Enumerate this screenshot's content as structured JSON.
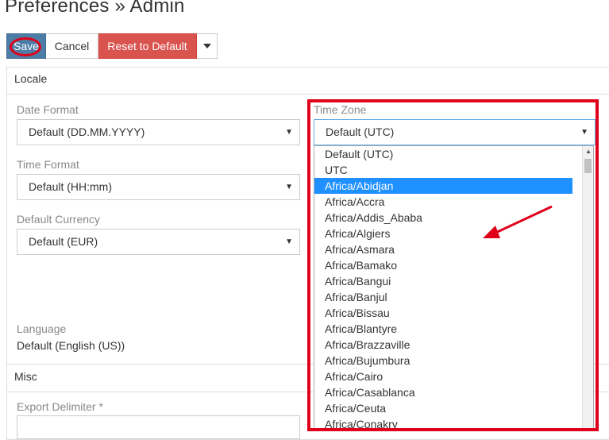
{
  "page": {
    "title": "Preferences » Admin"
  },
  "toolbar": {
    "save_label": "Save",
    "cancel_label": "Cancel",
    "reset_label": "Reset to Default",
    "caret_icon": "caret-down-icon"
  },
  "locale": {
    "heading": "Locale",
    "date_format": {
      "label": "Date Format",
      "value": "Default (DD.MM.YYYY)"
    },
    "time_format": {
      "label": "Time Format",
      "value": "Default (HH:mm)"
    },
    "default_currency": {
      "label": "Default Currency",
      "value": "Default (EUR)"
    },
    "language": {
      "label": "Language",
      "value": "Default (English (US))"
    },
    "time_zone": {
      "label": "Time Zone",
      "value": "Default (UTC)",
      "options": [
        "Default (UTC)",
        "UTC",
        "Africa/Abidjan",
        "Africa/Accra",
        "Africa/Addis_Ababa",
        "Africa/Algiers",
        "Africa/Asmara",
        "Africa/Bamako",
        "Africa/Bangui",
        "Africa/Banjul",
        "Africa/Bissau",
        "Africa/Blantyre",
        "Africa/Brazzaville",
        "Africa/Bujumbura",
        "Africa/Cairo",
        "Africa/Casablanca",
        "Africa/Ceuta",
        "Africa/Conakry"
      ],
      "highlighted": "Africa/Abidjan"
    }
  },
  "misc": {
    "heading": "Misc",
    "export_delimiter": {
      "label": "Export Delimiter *"
    }
  },
  "annotations": {
    "highlight_color": "#e0001a"
  }
}
